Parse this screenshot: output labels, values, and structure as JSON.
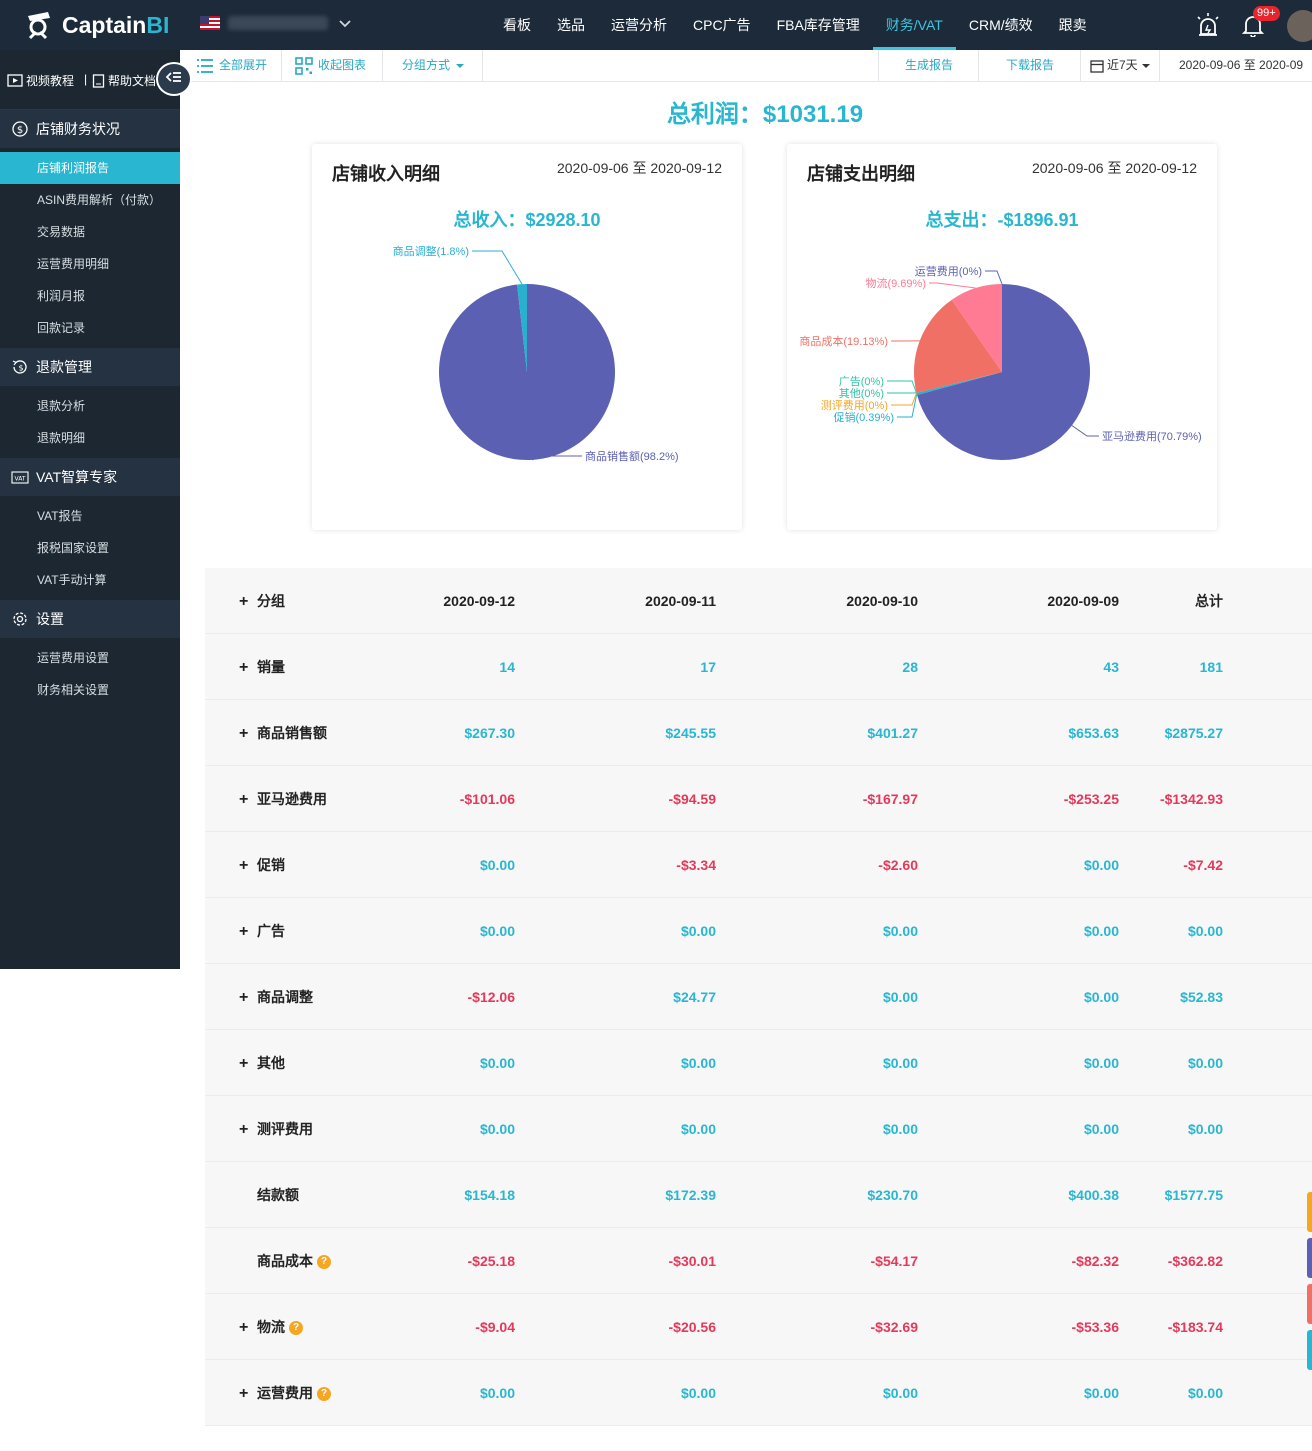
{
  "app": {
    "logo_text": "Captain",
    "logo_bi": "BI",
    "alerts_badge": "99+"
  },
  "nav": [
    {
      "label": "看板",
      "active": false
    },
    {
      "label": "选品",
      "active": false
    },
    {
      "label": "运营分析",
      "active": false
    },
    {
      "label": "CPC广告",
      "active": false
    },
    {
      "label": "FBA库存管理",
      "active": false
    },
    {
      "label": "财务/VAT",
      "active": true
    },
    {
      "label": "CRM/绩效",
      "active": false
    },
    {
      "label": "跟卖",
      "active": false
    }
  ],
  "sidebar": {
    "video_label": "视频教程",
    "help_label": "帮助文档",
    "groups": [
      {
        "title": "店铺财务状况",
        "icon": "dollar-circle-icon",
        "items": [
          {
            "label": "店铺利润报告",
            "active": true
          },
          {
            "label": "ASIN费用解析（付款）",
            "active": false
          },
          {
            "label": "交易数据",
            "active": false
          },
          {
            "label": "运营费用明细",
            "active": false
          },
          {
            "label": "利润月报",
            "active": false
          },
          {
            "label": "回款记录",
            "active": false
          }
        ]
      },
      {
        "title": "退款管理",
        "icon": "refund-icon",
        "items": [
          {
            "label": "退款分析",
            "active": false
          },
          {
            "label": "退款明细",
            "active": false
          }
        ]
      },
      {
        "title": "VAT智算专家",
        "icon": "vat-icon",
        "items": [
          {
            "label": "VAT报告",
            "active": false
          },
          {
            "label": "报税国家设置",
            "active": false
          },
          {
            "label": "VAT手动计算",
            "active": false
          }
        ]
      },
      {
        "title": "设置",
        "icon": "gear-icon",
        "items": [
          {
            "label": "运营费用设置",
            "active": false
          },
          {
            "label": "财务相关设置",
            "active": false
          }
        ]
      }
    ]
  },
  "toolbar": {
    "expand_all": "全部展开",
    "collapse_chart": "收起图表",
    "group_by": "分组方式",
    "generate_report": "生成报告",
    "download_report": "下载报告",
    "range": "近7天",
    "date_range": "2020-09-06 至 2020-09"
  },
  "summary": {
    "total_profit": "总利润：$1031.19"
  },
  "income_card": {
    "title": "店铺收入明细",
    "date": "2020-09-06 至 2020-09-12",
    "total": "总收入：$2928.10",
    "slices": [
      {
        "label": "商品销售额(98.2%)",
        "value": 98.2,
        "color": "#5c60b3"
      },
      {
        "label": "商品调整(1.8%)",
        "value": 1.8,
        "color": "#2ab0cf"
      }
    ]
  },
  "expense_card": {
    "title": "店铺支出明细",
    "date": "2020-09-06 至 2020-09-12",
    "total": "总支出：-$1896.91",
    "slices": [
      {
        "label": "亚马逊费用(70.79%)",
        "value": 70.79,
        "color": "#5c60b3"
      },
      {
        "label": "促销(0.39%)",
        "value": 0.39,
        "color": "#2ab0cf"
      },
      {
        "label": "测评费用(0%)",
        "value": 0,
        "color": "#f5a623"
      },
      {
        "label": "其他(0%)",
        "value": 0,
        "color": "#31c3a5"
      },
      {
        "label": "广告(0%)",
        "value": 0,
        "color": "#33c6a0"
      },
      {
        "label": "商品成本(19.13%)",
        "value": 19.13,
        "color": "#f07065"
      },
      {
        "label": "物流(9.69%)",
        "value": 9.69,
        "color": "#ff7a93"
      },
      {
        "label": "运营费用(0%)",
        "value": 0,
        "color": "#5c60b3"
      }
    ]
  },
  "table": {
    "header": {
      "label": "分组",
      "cols": [
        "2020-09-12",
        "2020-09-11",
        "2020-09-10",
        "2020-09-09",
        "总计"
      ]
    },
    "rows": [
      {
        "label": "销量",
        "plus": true,
        "help": false,
        "values": [
          "14",
          "17",
          "28",
          "43",
          "181"
        ]
      },
      {
        "label": "商品销售额",
        "plus": true,
        "help": false,
        "values": [
          "$267.30",
          "$245.55",
          "$401.27",
          "$653.63",
          "$2875.27"
        ]
      },
      {
        "label": "亚马逊费用",
        "plus": true,
        "help": false,
        "values": [
          "-$101.06",
          "-$94.59",
          "-$167.97",
          "-$253.25",
          "-$1342.93"
        ]
      },
      {
        "label": "促销",
        "plus": true,
        "help": false,
        "values": [
          "$0.00",
          "-$3.34",
          "-$2.60",
          "$0.00",
          "-$7.42"
        ]
      },
      {
        "label": "广告",
        "plus": true,
        "help": false,
        "values": [
          "$0.00",
          "$0.00",
          "$0.00",
          "$0.00",
          "$0.00"
        ]
      },
      {
        "label": "商品调整",
        "plus": true,
        "help": false,
        "values": [
          "-$12.06",
          "$24.77",
          "$0.00",
          "$0.00",
          "$52.83"
        ]
      },
      {
        "label": "其他",
        "plus": true,
        "help": false,
        "values": [
          "$0.00",
          "$0.00",
          "$0.00",
          "$0.00",
          "$0.00"
        ]
      },
      {
        "label": "测评费用",
        "plus": true,
        "help": false,
        "values": [
          "$0.00",
          "$0.00",
          "$0.00",
          "$0.00",
          "$0.00"
        ]
      },
      {
        "label": "结款额",
        "plus": false,
        "help": false,
        "values": [
          "$154.18",
          "$172.39",
          "$230.70",
          "$400.38",
          "$1577.75"
        ]
      },
      {
        "label": "商品成本",
        "plus": false,
        "help": true,
        "values": [
          "-$25.18",
          "-$30.01",
          "-$54.17",
          "-$82.32",
          "-$362.82"
        ]
      },
      {
        "label": "物流",
        "plus": true,
        "help": true,
        "values": [
          "-$9.04",
          "-$20.56",
          "-$32.69",
          "-$53.36",
          "-$183.74"
        ]
      },
      {
        "label": "运营费用",
        "plus": true,
        "help": true,
        "values": [
          "$0.00",
          "$0.00",
          "$0.00",
          "$0.00",
          "$0.00"
        ]
      }
    ]
  },
  "colors": {
    "accent": "#29b6d1",
    "negative": "#e4395b",
    "topbar": "#1c2a39",
    "sidebar": "#1c2731"
  }
}
